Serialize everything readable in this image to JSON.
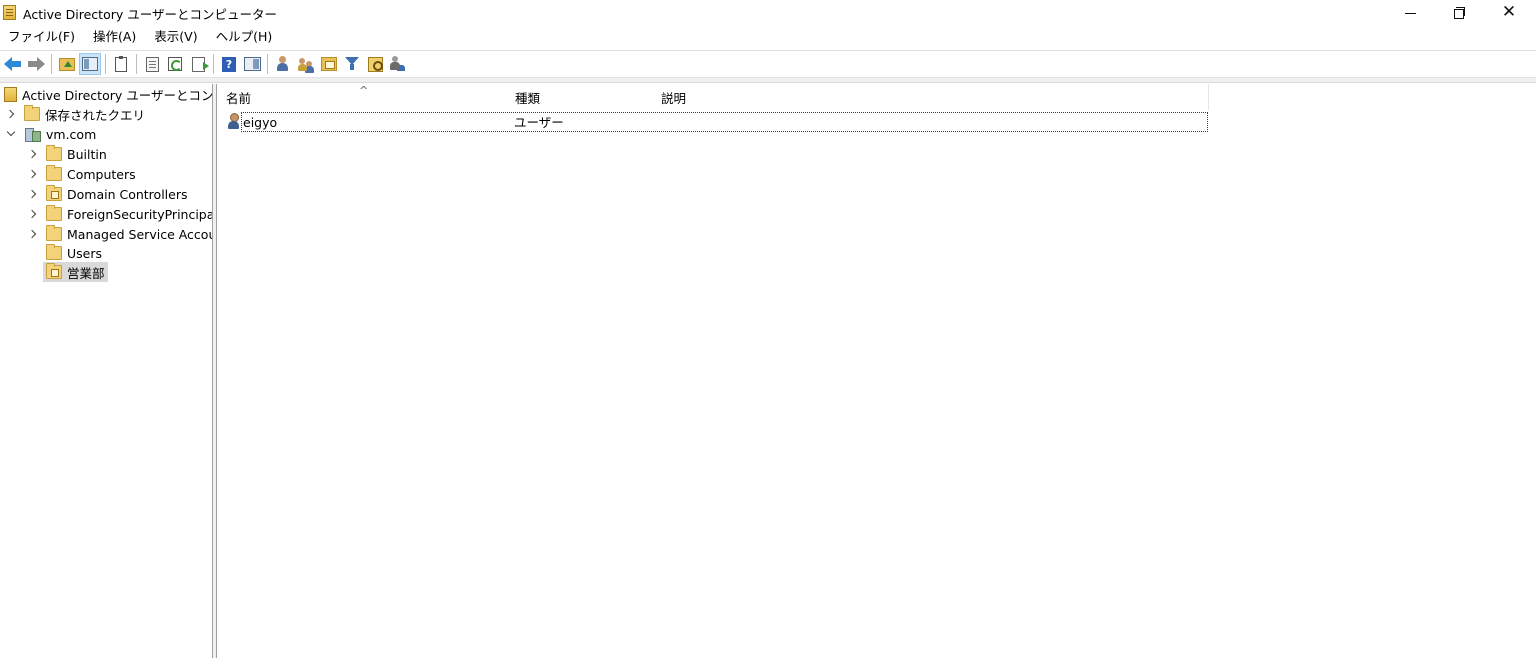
{
  "window": {
    "title": "Active Directory ユーザーとコンピューター",
    "controls": {
      "minimize": "minimize-icon",
      "maximize": "restore-icon",
      "close": "close-icon"
    }
  },
  "menu": [
    {
      "label": "ファイル(F)"
    },
    {
      "label": "操作(A)"
    },
    {
      "label": "表示(V)"
    },
    {
      "label": "ヘルプ(H)"
    }
  ],
  "toolbar": [
    "back-arrow-icon",
    "forward-arrow-icon",
    "up-one-level-icon",
    "show-hide-console-tree-icon",
    "properties-icon",
    "export-list-icon",
    "refresh-icon",
    "export-icon",
    "help-icon",
    "show-hide-action-pane-icon",
    "create-user-icon",
    "create-group-icon",
    "create-ou-icon",
    "filter-icon",
    "find-icon",
    "add-to-group-icon"
  ],
  "tree": {
    "root": "Active Directory ユーザーとコンピュ-",
    "saved_queries": "保存されたクエリ",
    "domain": "vm.com",
    "children": [
      {
        "label": "Builtin"
      },
      {
        "label": "Computers"
      },
      {
        "label": "Domain Controllers"
      },
      {
        "label": "ForeignSecurityPrincipals"
      },
      {
        "label": "Managed Service Accour"
      },
      {
        "label": "Users"
      },
      {
        "label": "営業部"
      }
    ]
  },
  "list": {
    "columns": [
      {
        "label": "名前"
      },
      {
        "label": "種類"
      },
      {
        "label": "説明"
      }
    ],
    "sort_indicator": "^",
    "rows": [
      {
        "name": "eigyo",
        "type": "ユーザー",
        "description": ""
      }
    ]
  }
}
